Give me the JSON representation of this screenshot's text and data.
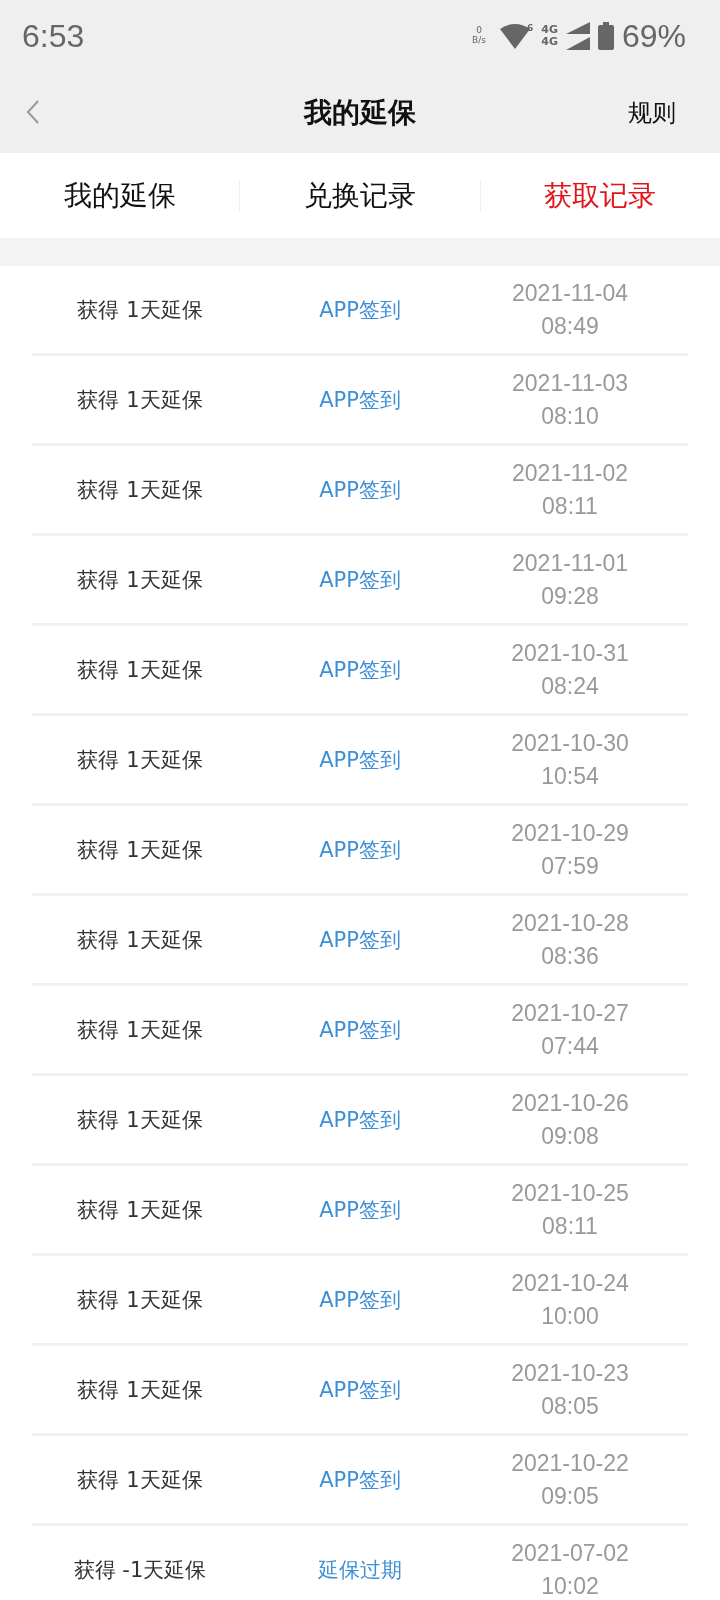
{
  "status_bar": {
    "time": "6:53",
    "net_speed_value": "0",
    "net_speed_unit": "B/s",
    "wifi_badge": "6",
    "sim_1": "4G",
    "sim_2": "4G",
    "battery": "69%"
  },
  "header": {
    "title": "我的延保",
    "action": "规则"
  },
  "tabs": [
    {
      "label": "我的延保",
      "selected": false
    },
    {
      "label": "兑换记录",
      "selected": false
    },
    {
      "label": "获取记录",
      "selected": true
    }
  ],
  "records": [
    {
      "amount": "获得 1天延保",
      "source": "APP签到",
      "date": "2021-11-04",
      "time": "08:49"
    },
    {
      "amount": "获得 1天延保",
      "source": "APP签到",
      "date": "2021-11-03",
      "time": "08:10"
    },
    {
      "amount": "获得 1天延保",
      "source": "APP签到",
      "date": "2021-11-02",
      "time": "08:11"
    },
    {
      "amount": "获得 1天延保",
      "source": "APP签到",
      "date": "2021-11-01",
      "time": "09:28"
    },
    {
      "amount": "获得 1天延保",
      "source": "APP签到",
      "date": "2021-10-31",
      "time": "08:24"
    },
    {
      "amount": "获得 1天延保",
      "source": "APP签到",
      "date": "2021-10-30",
      "time": "10:54"
    },
    {
      "amount": "获得 1天延保",
      "source": "APP签到",
      "date": "2021-10-29",
      "time": "07:59"
    },
    {
      "amount": "获得 1天延保",
      "source": "APP签到",
      "date": "2021-10-28",
      "time": "08:36"
    },
    {
      "amount": "获得 1天延保",
      "source": "APP签到",
      "date": "2021-10-27",
      "time": "07:44"
    },
    {
      "amount": "获得 1天延保",
      "source": "APP签到",
      "date": "2021-10-26",
      "time": "09:08"
    },
    {
      "amount": "获得 1天延保",
      "source": "APP签到",
      "date": "2021-10-25",
      "time": "08:11"
    },
    {
      "amount": "获得 1天延保",
      "source": "APP签到",
      "date": "2021-10-24",
      "time": "10:00"
    },
    {
      "amount": "获得 1天延保",
      "source": "APP签到",
      "date": "2021-10-23",
      "time": "08:05"
    },
    {
      "amount": "获得 1天延保",
      "source": "APP签到",
      "date": "2021-10-22",
      "time": "09:05"
    },
    {
      "amount": "获得 -1天延保",
      "source": "延保过期",
      "date": "2021-07-02",
      "time": "10:02"
    }
  ]
}
